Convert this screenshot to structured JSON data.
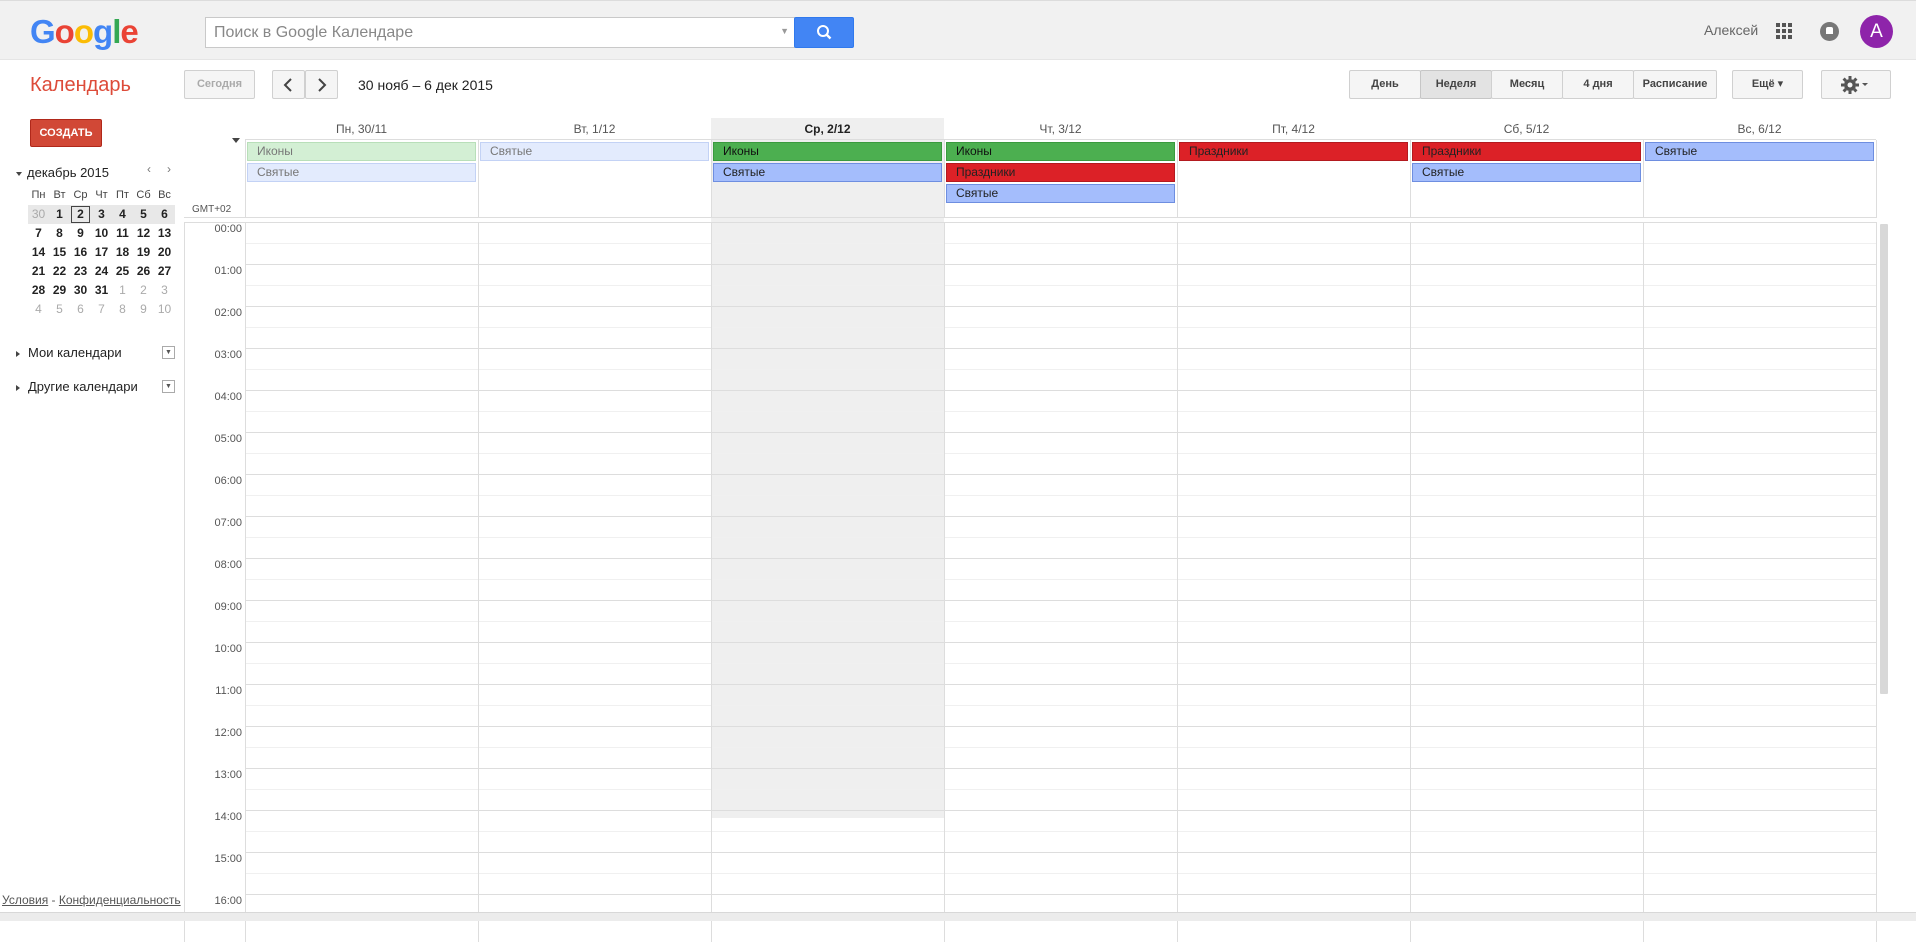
{
  "header": {
    "logo": "Google",
    "search_placeholder": "Поиск в Google Календаре",
    "user_name": "Алексей",
    "avatar_letter": "A",
    "avatar_color": "#8e24aa"
  },
  "toolbar": {
    "app_title": "Календарь",
    "today_label": "Сегодня",
    "date_range": "30 нояб – 6 дек 2015",
    "views": [
      "День",
      "Неделя",
      "Месяц",
      "4 дня",
      "Расписание"
    ],
    "active_view": "Неделя",
    "more_label": "Ещё ▾",
    "settings_icon": "gear-icon"
  },
  "sidebar": {
    "create_label": "СОЗДАТЬ",
    "mini_month": "декабрь 2015",
    "weekdays": [
      "Пн",
      "Вт",
      "Ср",
      "Чт",
      "Пт",
      "Сб",
      "Вс"
    ],
    "weeks": [
      [
        "30",
        "1",
        "2",
        "3",
        "4",
        "5",
        "6"
      ],
      [
        "7",
        "8",
        "9",
        "10",
        "11",
        "12",
        "13"
      ],
      [
        "14",
        "15",
        "16",
        "17",
        "18",
        "19",
        "20"
      ],
      [
        "21",
        "22",
        "23",
        "24",
        "25",
        "26",
        "27"
      ],
      [
        "28",
        "29",
        "30",
        "31",
        "1",
        "2",
        "3"
      ],
      [
        "4",
        "5",
        "6",
        "7",
        "8",
        "9",
        "10"
      ]
    ],
    "my_calendars": "Мои календари",
    "other_calendars": "Другие календари",
    "footer_terms": "Условия",
    "footer_sep": " - ",
    "footer_privacy": "Конфиденциальность"
  },
  "week": {
    "timezone": "GMT+02",
    "days": [
      {
        "label": "Пн, 30/11",
        "today": false
      },
      {
        "label": "Вт, 1/12",
        "today": false
      },
      {
        "label": "Ср, 2/12",
        "today": true
      },
      {
        "label": "Чт, 3/12",
        "today": false
      },
      {
        "label": "Пт, 4/12",
        "today": false
      },
      {
        "label": "Сб, 5/12",
        "today": false
      },
      {
        "label": "Вс, 6/12",
        "today": false
      }
    ],
    "allday_events": [
      {
        "day": 0,
        "slot": 0,
        "title": "Иконы",
        "type": "icons",
        "past": true
      },
      {
        "day": 0,
        "slot": 1,
        "title": "Святые",
        "type": "saints",
        "past": true
      },
      {
        "day": 1,
        "slot": 0,
        "title": "Святые",
        "type": "saints",
        "past": true
      },
      {
        "day": 2,
        "slot": 0,
        "title": "Иконы",
        "type": "icons",
        "past": false
      },
      {
        "day": 2,
        "slot": 1,
        "title": "Святые",
        "type": "saints",
        "past": false
      },
      {
        "day": 3,
        "slot": 0,
        "title": "Иконы",
        "type": "icons",
        "past": false
      },
      {
        "day": 3,
        "slot": 1,
        "title": "Праздники",
        "type": "holidays",
        "past": false
      },
      {
        "day": 3,
        "slot": 2,
        "title": "Святые",
        "type": "saints",
        "past": false
      },
      {
        "day": 4,
        "slot": 0,
        "title": "Праздники",
        "type": "holidays",
        "past": false
      },
      {
        "day": 5,
        "slot": 0,
        "title": "Праздники",
        "type": "holidays",
        "past": false
      },
      {
        "day": 5,
        "slot": 1,
        "title": "Святые",
        "type": "saints",
        "past": false
      },
      {
        "day": 6,
        "slot": 0,
        "title": "Святые",
        "type": "saints",
        "past": false
      }
    ],
    "hours": [
      "00:00",
      "01:00",
      "02:00",
      "03:00",
      "04:00",
      "05:00",
      "06:00",
      "07:00",
      "08:00",
      "09:00",
      "10:00",
      "11:00",
      "12:00",
      "13:00",
      "14:00",
      "15:00",
      "16:00"
    ]
  }
}
